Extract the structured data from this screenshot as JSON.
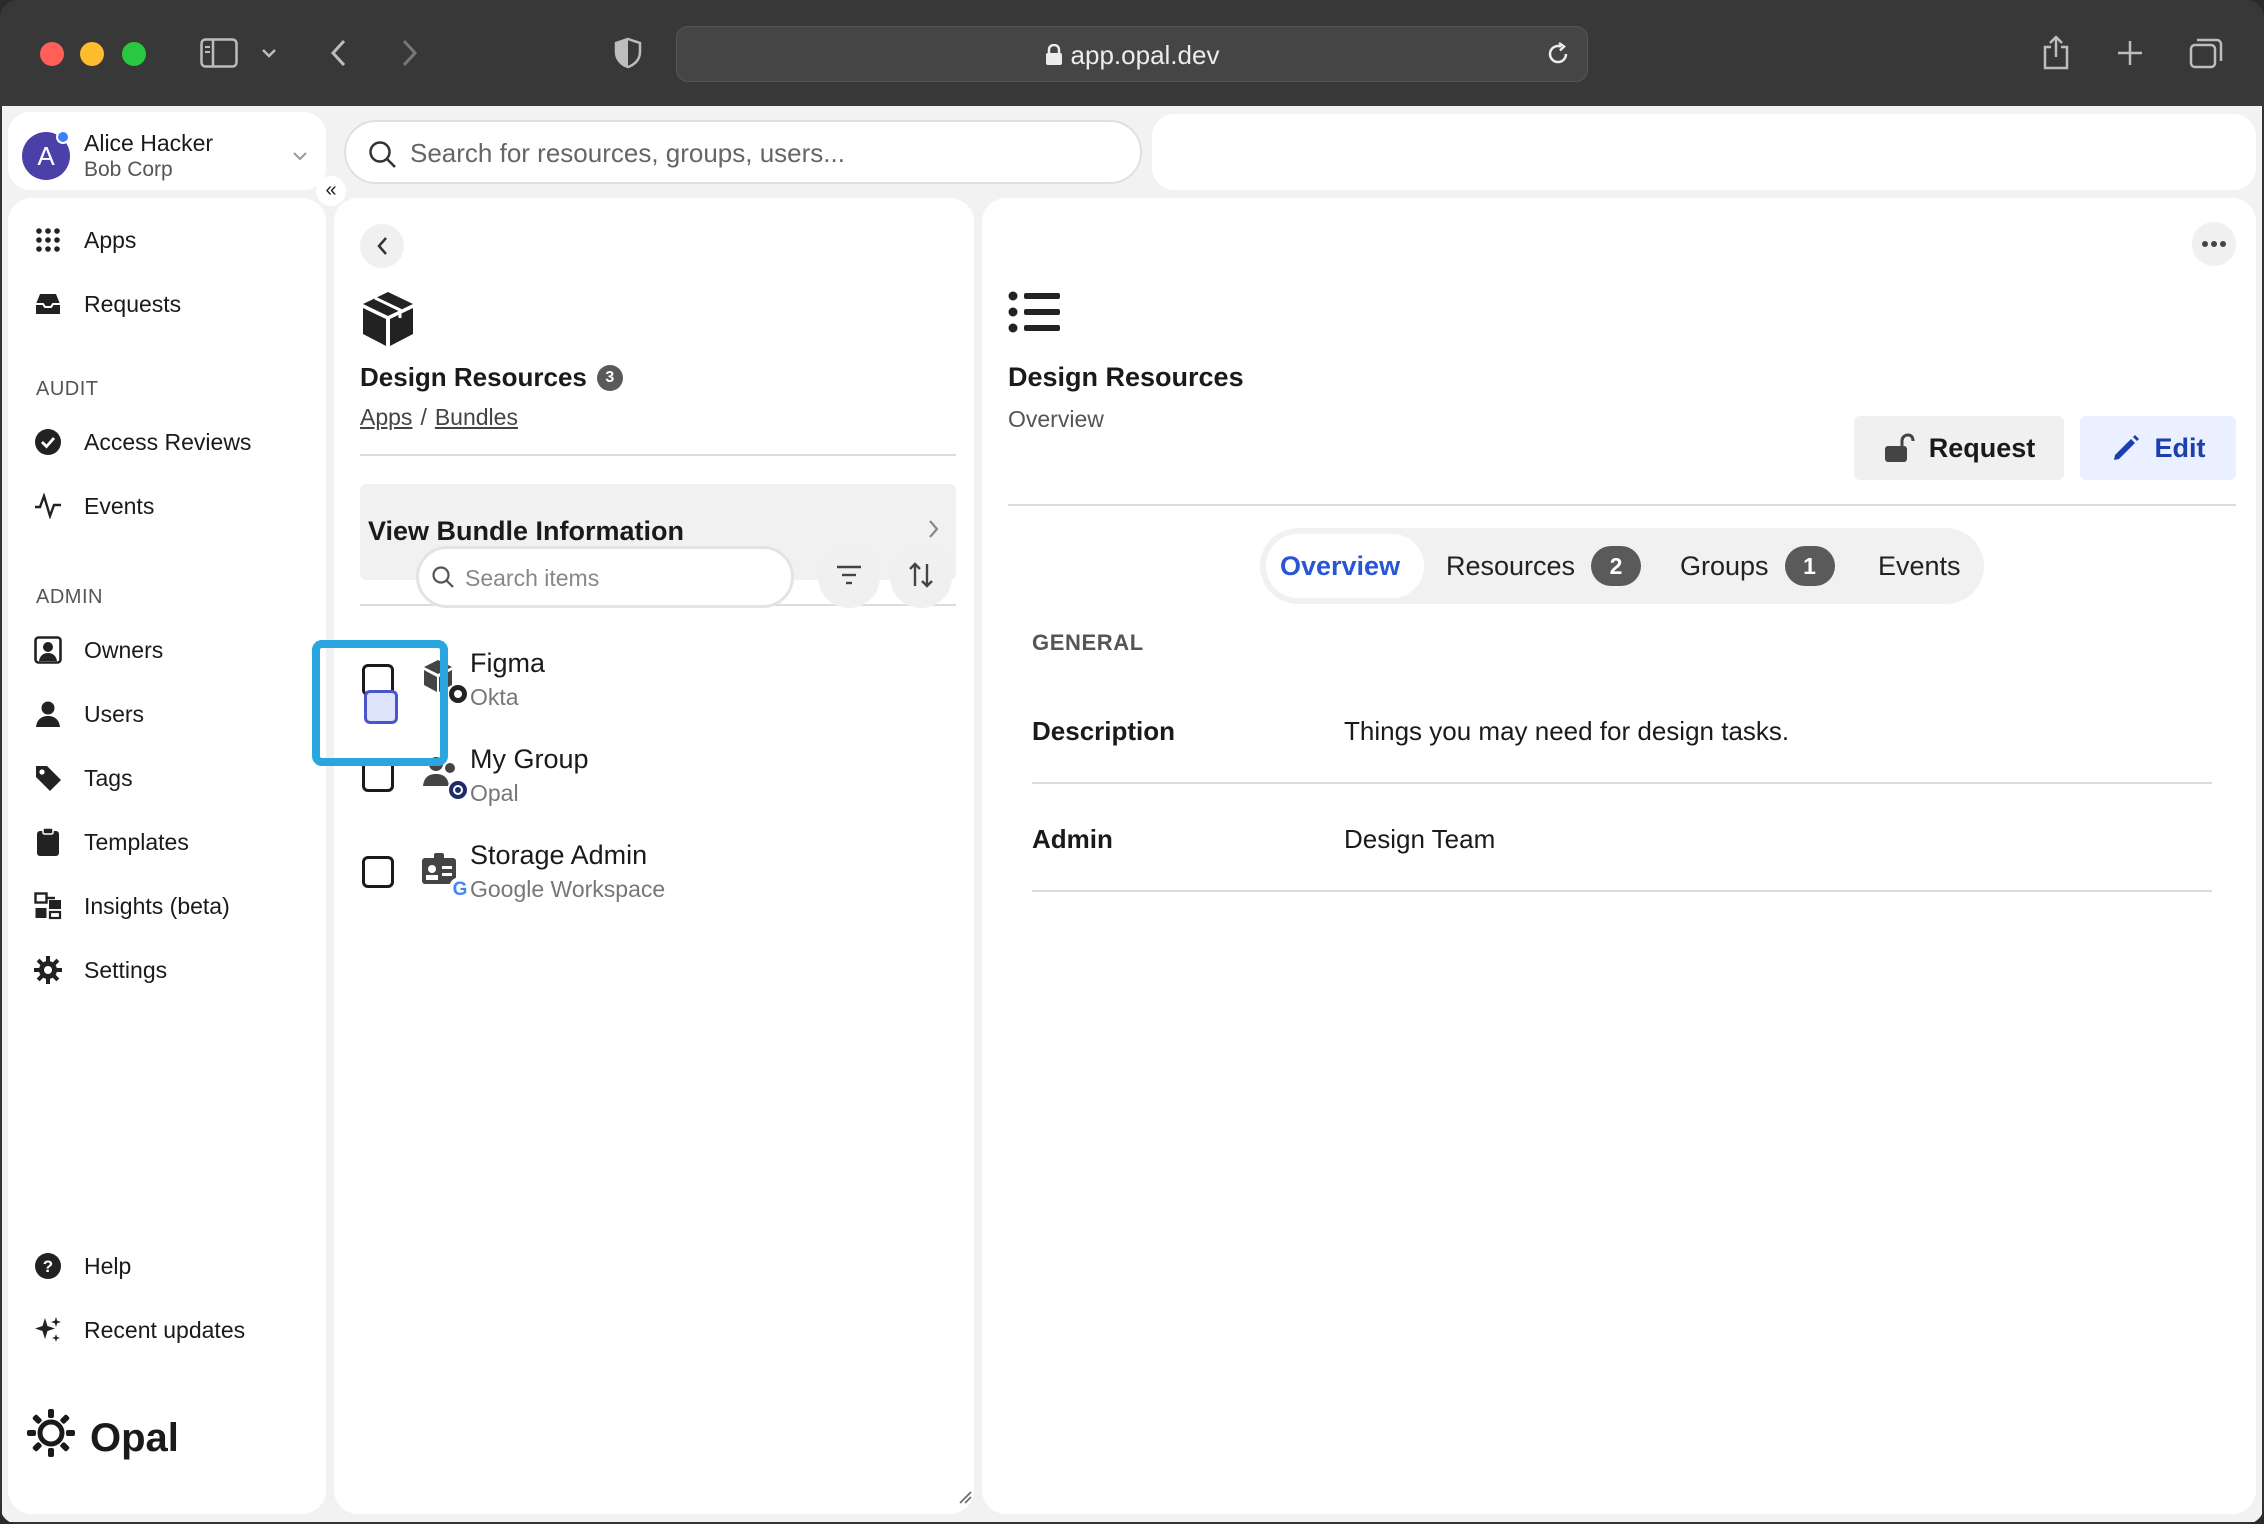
{
  "browser": {
    "url": "app.opal.dev"
  },
  "user": {
    "initial": "A",
    "name": "Alice Hacker",
    "org": "Bob Corp"
  },
  "global_search": {
    "placeholder": "Search for resources, groups, users..."
  },
  "sidebar": {
    "items": [
      {
        "label": "Apps",
        "icon": "grid-icon"
      },
      {
        "label": "Requests",
        "icon": "inbox-icon"
      }
    ],
    "audit_label": "AUDIT",
    "audit_items": [
      {
        "label": "Access Reviews",
        "icon": "check-circle-icon"
      },
      {
        "label": "Events",
        "icon": "activity-icon"
      }
    ],
    "admin_label": "ADMIN",
    "admin_items": [
      {
        "label": "Owners",
        "icon": "owner-icon"
      },
      {
        "label": "Users",
        "icon": "user-icon"
      },
      {
        "label": "Tags",
        "icon": "tag-icon"
      },
      {
        "label": "Templates",
        "icon": "clipboard-icon"
      },
      {
        "label": "Insights (beta)",
        "icon": "insights-icon"
      },
      {
        "label": "Settings",
        "icon": "gear-icon"
      }
    ],
    "bottom_items": [
      {
        "label": "Help",
        "icon": "help-icon"
      },
      {
        "label": "Recent updates",
        "icon": "sparkle-icon"
      }
    ],
    "brand": "Opal"
  },
  "bundle": {
    "title": "Design Resources",
    "count": "3",
    "breadcrumb": [
      "Apps",
      "Bundles"
    ],
    "breadcrumb_sep": "/",
    "info_button": "View Bundle Information",
    "search_placeholder": "Search items",
    "items": [
      {
        "name": "Figma",
        "source": "Okta"
      },
      {
        "name": "My Group",
        "source": "Opal"
      },
      {
        "name": "Storage Admin",
        "source": "Google Workspace"
      }
    ]
  },
  "detail": {
    "title": "Design Resources",
    "subtitle": "Overview",
    "request_label": "Request",
    "edit_label": "Edit",
    "tabs": [
      {
        "label": "Overview",
        "active": true
      },
      {
        "label": "Resources",
        "badge": "2"
      },
      {
        "label": "Groups",
        "badge": "1"
      },
      {
        "label": "Events"
      }
    ],
    "section": "GENERAL",
    "fields": [
      {
        "key": "Description",
        "value": "Things you may need for design tasks."
      },
      {
        "key": "Admin",
        "value": "Design Team"
      }
    ]
  },
  "colors": {
    "accent": "#2a56d6",
    "highlight": "#29a6e0",
    "avatar": "#4b3fa8"
  }
}
